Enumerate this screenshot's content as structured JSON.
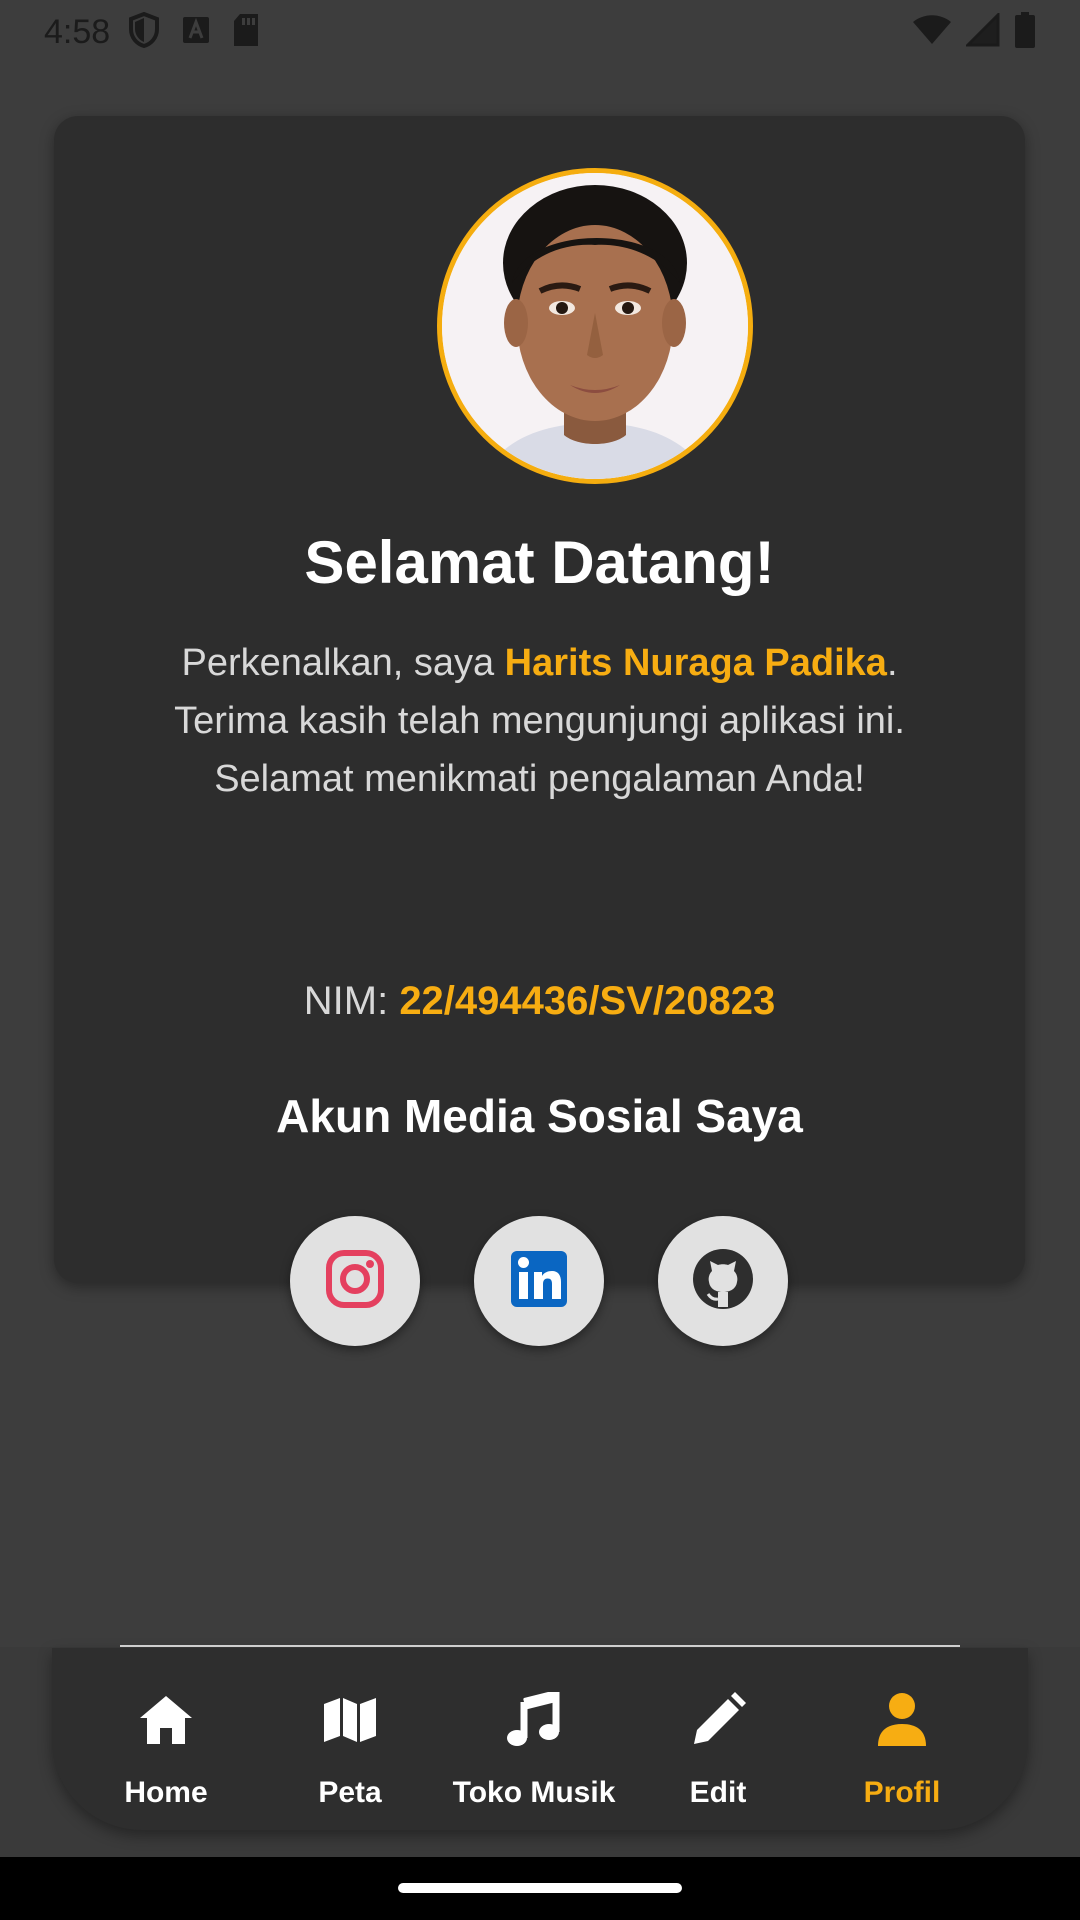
{
  "status_bar": {
    "time": "4:58"
  },
  "profile": {
    "welcome_title": "Selamat Datang!",
    "intro_prefix": "Perkenalkan, saya ",
    "name": "Harits Nuraga Padika",
    "intro_suffix": ".",
    "intro_line2": "Terima kasih telah mengunjungi aplikasi ini.",
    "intro_line3": "Selamat menikmati pengalaman Anda!",
    "nim_label": "NIM: ",
    "nim_value": "22/494436/SV/20823",
    "social_title": "Akun Media Sosial Saya",
    "social_links": [
      {
        "icon": "instagram-icon"
      },
      {
        "icon": "linkedin-icon"
      },
      {
        "icon": "github-icon"
      }
    ]
  },
  "bottom_nav": {
    "items": [
      {
        "label": "Home",
        "icon": "home-icon"
      },
      {
        "label": "Peta",
        "icon": "map-icon"
      },
      {
        "label": "Toko Musik",
        "icon": "music-note-icon"
      },
      {
        "label": "Edit",
        "icon": "pencil-icon"
      },
      {
        "label": "Profil",
        "icon": "person-icon",
        "active": true
      }
    ]
  },
  "colors": {
    "accent": "#f7ad12",
    "background": "#3d3d3d",
    "card": "#2d2d2d"
  }
}
